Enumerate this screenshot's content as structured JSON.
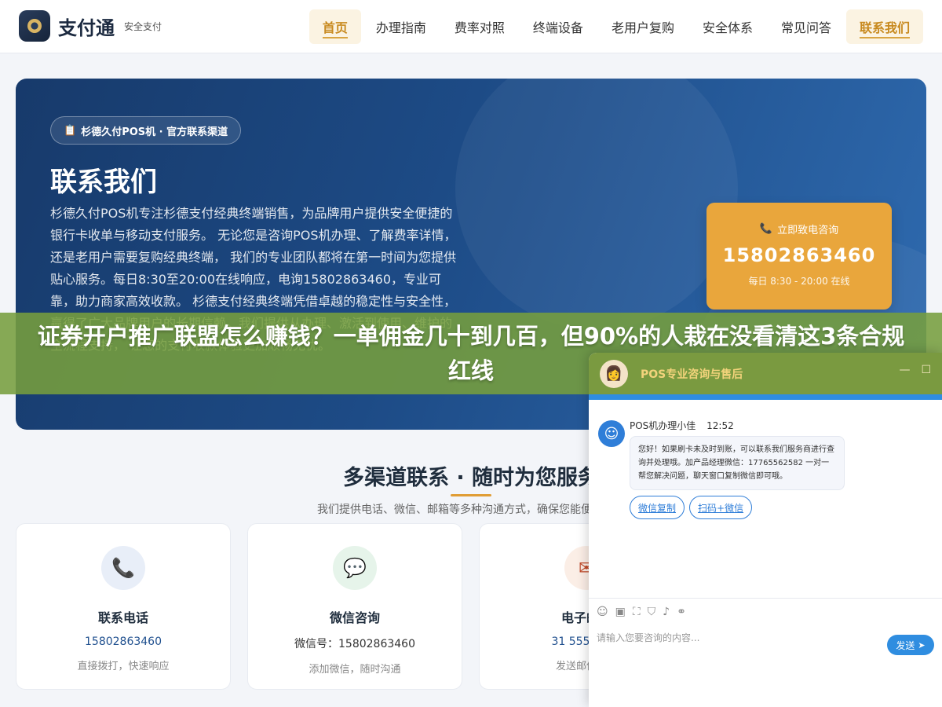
{
  "header": {
    "brand_name": "支付通",
    "brand_sub": "安全支付",
    "nav": [
      {
        "label": "首页"
      },
      {
        "label": "办理指南"
      },
      {
        "label": "费率对照"
      },
      {
        "label": "终端设备"
      },
      {
        "label": "老用户复购"
      },
      {
        "label": "安全体系"
      },
      {
        "label": "常见问答"
      },
      {
        "label": "联系我们"
      }
    ]
  },
  "hero": {
    "badge": "杉德久付POS机 · 官方联系渠道",
    "title": "联系我们",
    "description": "杉德久付POS机专注杉德支付经典终端销售，为品牌用户提供安全便捷的银行卡收单与移动支付服务。 无论您是咨询POS机办理、了解费率详情，还是老用户需要复购经典终端， 我们的专业团队都将在第一时间为您提供贴心服务。每日8:30至20:00在线响应，电询15802863460，专业可靠，助力商家高效收款。 杉德支付经典终端凭借卓越的稳定性与安全性，赢得了广大品牌用户的长期信赖。我们提供从办理、激活到使用、维护的全流程支持， 让您的支付收款体验更加顺畅无忧。",
    "call": {
      "label": "立即致电咨询",
      "number": "15802863460",
      "hours": "每日 8:30 - 20:00 在线"
    }
  },
  "banner": {
    "text": "证券开户推广联盟怎么赚钱？一单佣金几十到几百，但90%的人栽在没看清这3条合规红线"
  },
  "section": {
    "title": "多渠道联系 · 随时为您服务",
    "subtitle": "我们提供电话、微信、邮箱等多种沟通方式，确保您能便捷联系"
  },
  "cards": [
    {
      "title": "联系电话",
      "value": "15802863460",
      "note": "直接拨打，快速响应",
      "icon": "phone-icon"
    },
    {
      "title": "微信咨询",
      "value": "微信号：15802863460",
      "note": "添加微信，随时沟通",
      "icon": "chat-icon"
    },
    {
      "title": "电子邮箱",
      "value": "31 555555 3",
      "note": "发送邮件，详",
      "icon": "email-icon"
    }
  ],
  "chat": {
    "title": "POS专业咨询与售后",
    "agent_name": "POS机办理小佳",
    "time": "12:52",
    "message": "您好！如果刷卡未及时到账，可以联系我们服务商进行查询并处理哦。加产品经理微信：17765562582 一对一帮您解决问题，聊天窗口复制微信即可哦。",
    "buttons": [
      "微信复制",
      "扫码+微信"
    ],
    "input_placeholder": "请输入您要咨询的内容...",
    "send_label": "发送",
    "controls": [
      "—",
      "☐"
    ]
  },
  "colors": {
    "accent_gold": "#e9a63c",
    "hero_blue": "#1d4b86",
    "chat_blue": "#2f8de0",
    "banner_green": "#769e3e"
  }
}
